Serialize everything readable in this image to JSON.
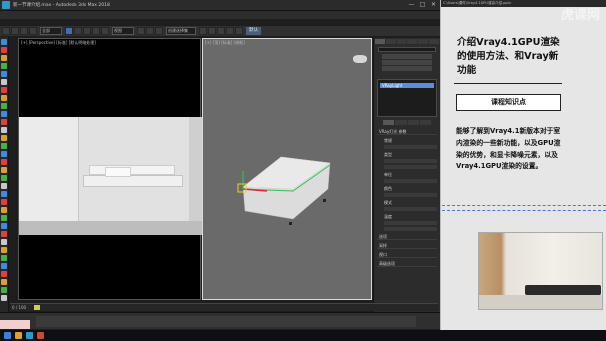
{
  "window": {
    "title": "新一节课介绍.max - Autodesk 3ds Max 2018",
    "controls": [
      "—",
      "□",
      "✕"
    ]
  },
  "toolbar": {
    "selection_filter": "全部",
    "view_dropdown": "视图",
    "selection_set": "创建选择集",
    "workspace_tab": "默认"
  },
  "viewports": {
    "left_label": "[+] [Perspective] [标准] [默认明暗处理]",
    "right_label": "[+] [顶] [标准] [线框]"
  },
  "command_panel": {
    "list_selected": "VRayLight",
    "sections": [
      "VRay灯光 参数",
      "选项",
      "采样",
      "视口",
      "高级选项"
    ],
    "sub_labels": [
      "常规",
      "类型",
      "单位",
      "颜色",
      "模式",
      "温度"
    ]
  },
  "timeline": {
    "frame": "0 / 100"
  },
  "slide": {
    "header": "C:\\Users\\课件\\Vray4.1GPU渲染介绍.pptx",
    "watermark": "虎课网",
    "title": "介绍Vray4.1GPU渲染的使用方法、和Vray新功能",
    "knowledge_point": "课程知识点",
    "body": "能够了解到Vray4.1新版本对于室内渲染的一些新功能，以及GPU渲染的优势，和显卡降噪元素，以及Vray4.1GPU渲染的设置。"
  },
  "colors": {
    "accent_blue": "#3f6fb8",
    "selection_blue": "#5a8fe0",
    "gizmo_red": "#e02a2a",
    "gizmo_green": "#32c24a",
    "gizmo_yellow": "#f0d020"
  },
  "icons": [
    "app-icon",
    "undo-icon",
    "redo-icon",
    "link-icon",
    "select-icon",
    "move-icon",
    "rotate-icon",
    "scale-icon",
    "viewcube-icon",
    "windows-start-icon"
  ]
}
